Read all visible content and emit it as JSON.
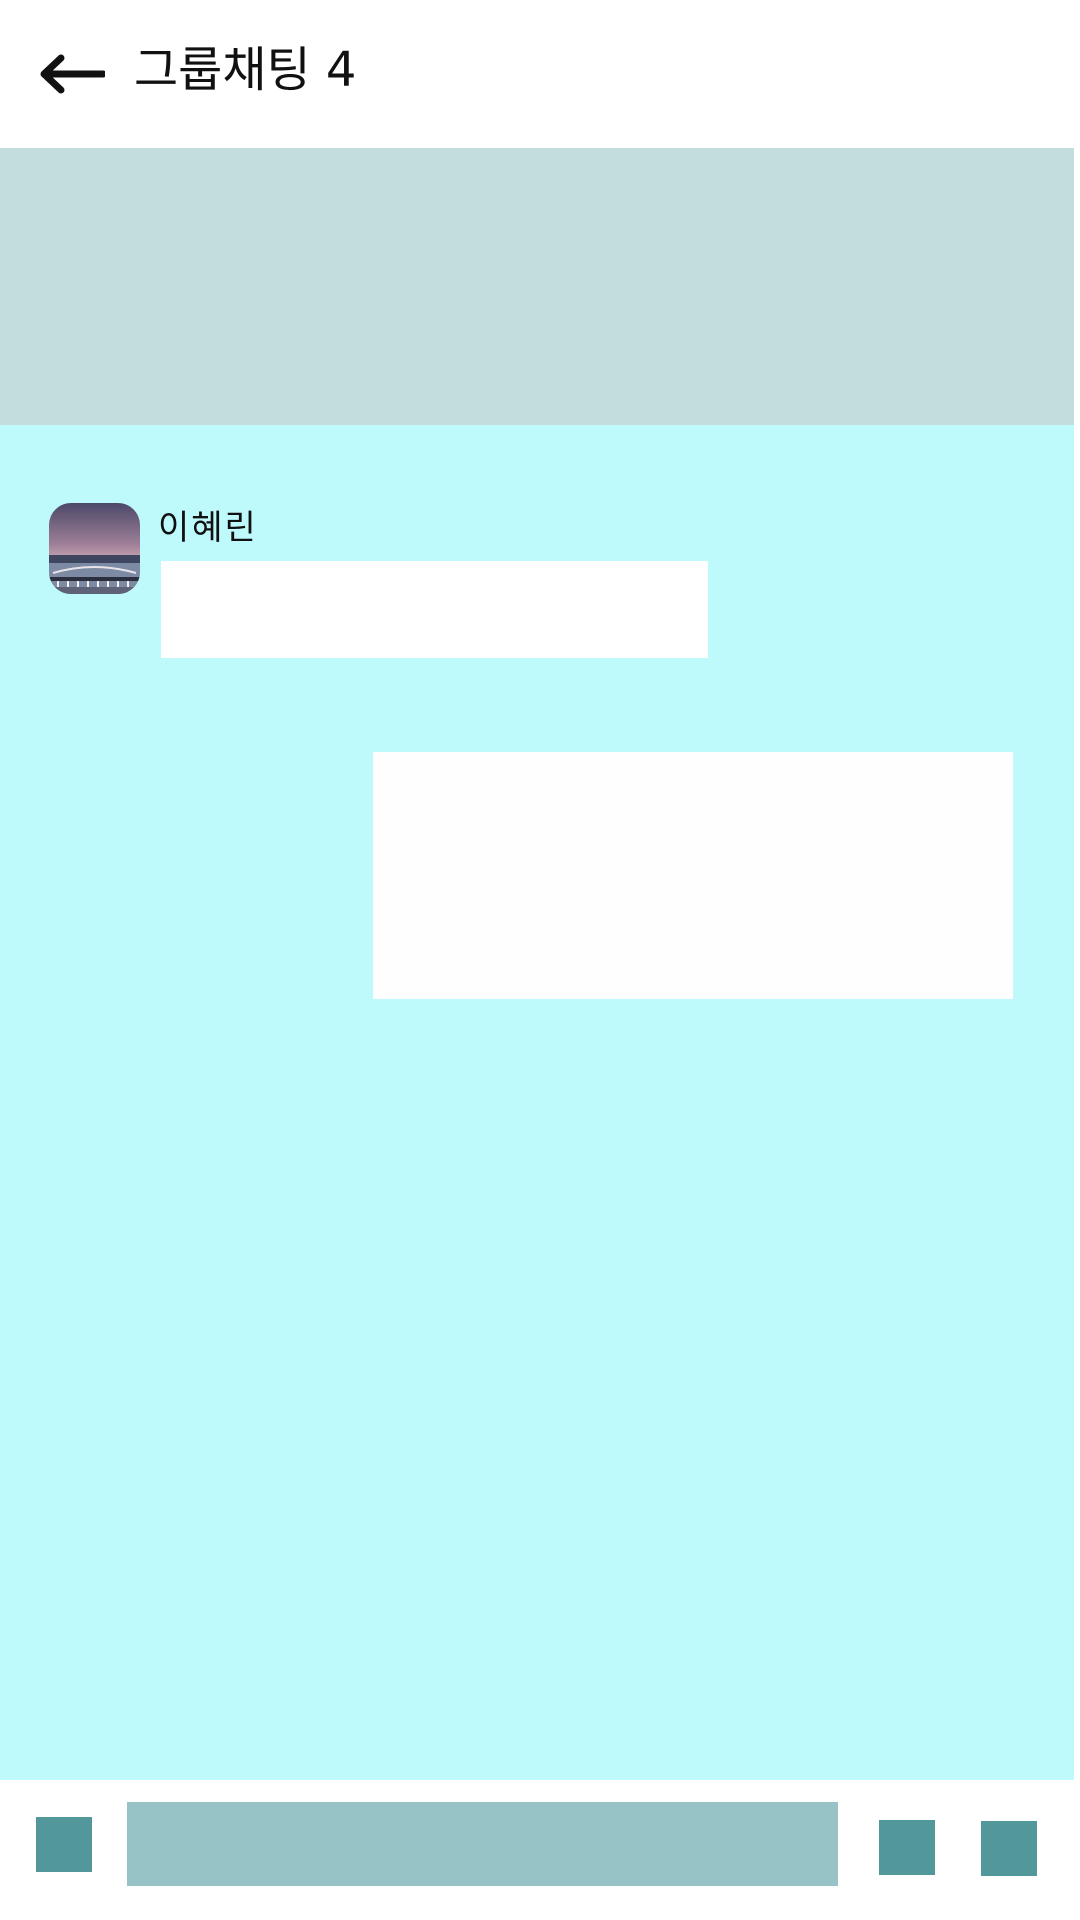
{
  "header": {
    "back_icon": "arrow-left-icon",
    "title": "그룹채팅 4"
  },
  "banner": {
    "color": "#c3dcde"
  },
  "chat": {
    "background": "#bef9fb",
    "messages": [
      {
        "direction": "received",
        "sender_name": "이혜린",
        "avatar_icon": "profile-photo-avatar",
        "text": ""
      },
      {
        "direction": "sent",
        "text": ""
      }
    ]
  },
  "input_bar": {
    "attach_icon": "attach-icon",
    "input_value": "",
    "input_placeholder": "",
    "emoji_icon": "emoji-icon",
    "send_icon": "send-icon",
    "button_color": "#529799",
    "input_color": "#98c3c6"
  }
}
